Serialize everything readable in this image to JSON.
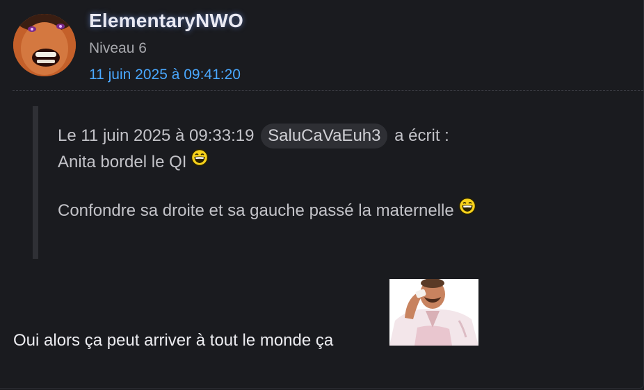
{
  "post": {
    "author": "ElementaryNWO",
    "level": "Niveau 6",
    "date": "11 juin 2025 à 09:41:20"
  },
  "quote": {
    "header_prefix": "Le 11 juin 2025 à 09:33:19",
    "quoted_user": "SaluCaVaEuh3",
    "header_suffix": "a écrit :",
    "line1": "Anita bordel le QI",
    "line2": "Confondre sa droite et sa gauche passé la maternelle"
  },
  "reply": {
    "text": "Oui alors ça peut arriver à tout le monde ça"
  },
  "icons": {
    "avatar": "laughing-face-avatar",
    "smiley": "big-laugh-smiley-icon",
    "sticker": "laughing-man-wiping-tears-sticker"
  },
  "colors": {
    "background": "#1a1b1f",
    "username": "#e9e9f2",
    "date_link": "#4aa8ff",
    "quote_bar": "#2f3035",
    "mention_bg": "#2e2f34"
  }
}
